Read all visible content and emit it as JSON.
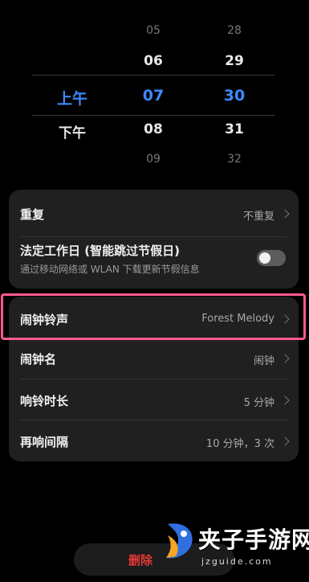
{
  "picker": {
    "period": {
      "selected": "上午",
      "below": "下午"
    },
    "hour": {
      "r1": "05",
      "r2": "06",
      "selected": "07",
      "r4": "08",
      "r5": "09"
    },
    "minute": {
      "r1": "28",
      "r2": "29",
      "selected": "30",
      "r4": "31",
      "r5": "32"
    }
  },
  "settings_card1": {
    "repeat": {
      "label": "重复",
      "value": "不重复"
    },
    "workday": {
      "label": "法定工作日 (智能跳过节假日)",
      "sub": "通过移动网络或 WLAN 下载更新节假信息",
      "toggle_on": false
    }
  },
  "settings_card2": {
    "ringtone": {
      "label": "闹钟铃声",
      "value": "Forest Melody"
    },
    "name": {
      "label": "闹钟名",
      "value": "闹钟"
    },
    "duration": {
      "label": "响铃时长",
      "value": "5 分钟"
    },
    "snooze": {
      "label": "再响间隔",
      "value": "10 分钟，3 次"
    }
  },
  "footer": {
    "delete_label": "删除"
  },
  "watermark": {
    "title": "夹子手游网",
    "url": "jzguide.com"
  },
  "colors": {
    "accent": "#3d8bff",
    "highlight": "#ff5a8c",
    "danger": "#e53935"
  }
}
